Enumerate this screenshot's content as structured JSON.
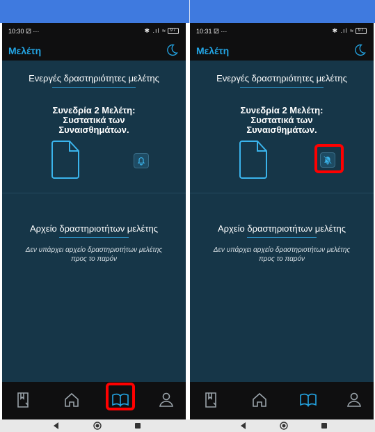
{
  "left": {
    "status": {
      "time": "10:30",
      "time_extra": "⚂ ···",
      "signals": "✱ .ıl ≈",
      "battery": "97"
    },
    "appbar": {
      "title": "Μελέτη"
    },
    "active": {
      "heading": "Ενεργές δραστηριότητες μελέτης",
      "session_line1": "Συνεδρία 2 Μελέτη:",
      "session_line2": "Συστατικά των",
      "session_line3": "Συναισθημάτων."
    },
    "archive": {
      "heading": "Αρχείο δραστηριοτήτων μελέτης",
      "empty_line1": "Δεν υπάρχει αρχείο δραστηριοτήτων μελέτης",
      "empty_line2": "προς το παρόν"
    },
    "bell_state": "bell-icon",
    "highlighted": "nav-study"
  },
  "right": {
    "status": {
      "time": "10:31",
      "time_extra": "⚂ ···",
      "signals": "✱ .ıl ≈",
      "battery": "97"
    },
    "appbar": {
      "title": "Μελέτη"
    },
    "active": {
      "heading": "Ενεργές δραστηριότητες μελέτης",
      "session_line1": "Συνεδρία 2 Μελέτη:",
      "session_line2": "Συστατικά των",
      "session_line3": "Συναισθημάτων."
    },
    "archive": {
      "heading": "Αρχείο δραστηριοτήτων μελέτης",
      "empty_line1": "Δεν υπάρχει αρχείο δραστηριοτήτων μελέτης",
      "empty_line2": "προς το παρόν"
    },
    "bell_state": "bell-off-icon",
    "highlighted": "bell-button"
  },
  "nav_icons": [
    "study-journal-icon",
    "home-icon",
    "book-icon",
    "profile-icon"
  ],
  "colors": {
    "accent": "#23a4e3",
    "background": "#163648",
    "bars": "#0f0f10",
    "highlight": "#ff0000",
    "banner": "#3f7adf"
  }
}
